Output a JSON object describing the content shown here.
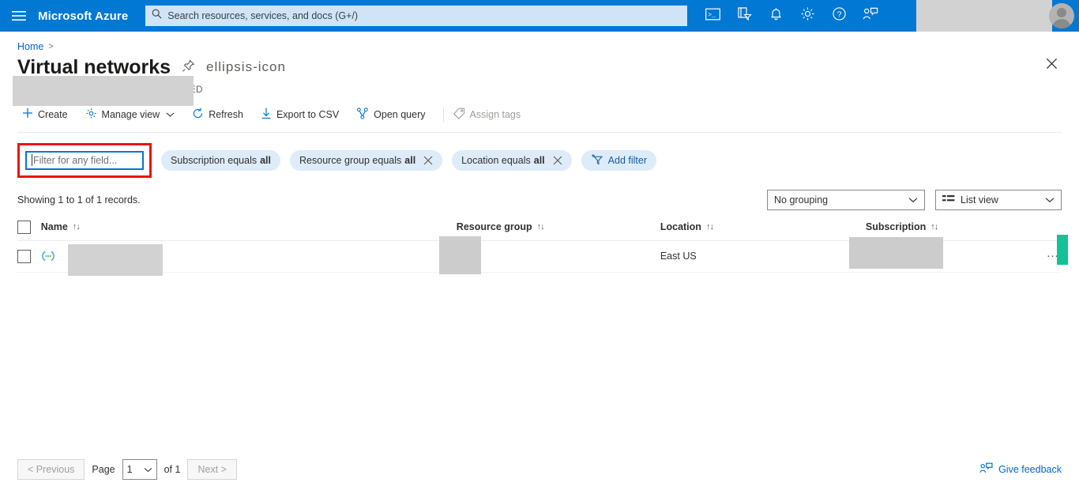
{
  "topbar": {
    "menu_icon": "hamburger-icon",
    "brand": "Microsoft Azure",
    "search_placeholder": "Search resources, services, and docs (G+/)",
    "search_icon": "search-icon",
    "icons": [
      {
        "name": "cloud-shell-icon",
        "title": "Cloud Shell"
      },
      {
        "name": "directories-subscriptions-icon",
        "title": "Directories + subscriptions"
      },
      {
        "name": "notifications-bell-icon",
        "title": "Notifications"
      },
      {
        "name": "settings-gear-icon",
        "title": "Settings"
      },
      {
        "name": "help-question-icon",
        "title": "Help"
      },
      {
        "name": "feedback-person-icon",
        "title": "Feedback"
      }
    ],
    "account_redacted": "",
    "avatar": "user-avatar"
  },
  "breadcrumb": {
    "home": "Home",
    "separator": ">"
  },
  "page": {
    "title": "Virtual networks",
    "pin_icon": "pin-icon",
    "more_icon": "ellipsis-icon",
    "close_icon": "close-icon",
    "subtitle_visible_fragment": "ED"
  },
  "toolbar": {
    "create": "Create",
    "manage_view": "Manage view",
    "refresh": "Refresh",
    "export_csv": "Export to CSV",
    "open_query": "Open query",
    "assign_tags": "Assign tags"
  },
  "filters": {
    "field_filter_placeholder": "Filter for any field...",
    "field_filter_value": "",
    "pills": [
      {
        "label": "Subscription equals ",
        "value": "all",
        "closable": false
      },
      {
        "label": "Resource group equals ",
        "value": "all",
        "closable": true
      },
      {
        "label": "Location equals ",
        "value": "all",
        "closable": true
      }
    ],
    "add_filter": "Add filter"
  },
  "results": {
    "records_text": "Showing 1 to 1 of 1 records.",
    "grouping": "No grouping",
    "view": "List view"
  },
  "table": {
    "columns": [
      {
        "label": "Name",
        "sort": "↑↓"
      },
      {
        "label": "Resource group",
        "sort": "↑↓"
      },
      {
        "label": "Location",
        "sort": "↑↓"
      },
      {
        "label": "Subscription",
        "sort": "↑↓"
      }
    ],
    "rows": [
      {
        "name": "",
        "resource_group": "",
        "location": "East US",
        "subscription": "",
        "icon": "virtual-network-icon",
        "row_menu": "…"
      }
    ]
  },
  "footer": {
    "previous": "< Previous",
    "page_label": "Page",
    "page_value": "1",
    "of_label": "of 1",
    "next": "Next >",
    "give_feedback": "Give feedback",
    "feedback_icon": "feedback-person-icon"
  },
  "colors": {
    "azure_blue": "#0078d4",
    "pill_blue": "#deecf9",
    "link_blue": "#0066cc",
    "annotation_red": "#ee1111",
    "annotation_green": "#13c296",
    "redaction_gray": "#d2d2d2"
  }
}
